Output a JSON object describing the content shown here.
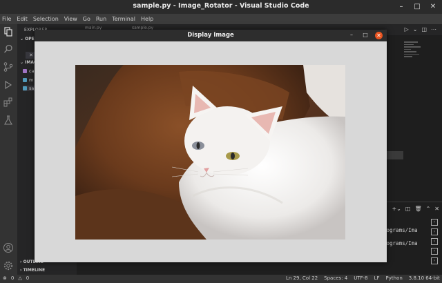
{
  "window": {
    "title": "sample.py - Image_Rotator - Visual Studio Code"
  },
  "menu": [
    "File",
    "Edit",
    "Selection",
    "View",
    "Go",
    "Run",
    "Terminal",
    "Help"
  ],
  "sidebar": {
    "header": "EXPLORER",
    "open_editors": "OPE",
    "folder": "IMAG",
    "files": [
      {
        "label": "ca",
        "color": "#a074c4"
      },
      {
        "label": "m",
        "color": "#519aba"
      },
      {
        "label": "sa",
        "color": "#519aba"
      }
    ],
    "outline": "OUTLINE",
    "timeline": "TIMELINE"
  },
  "editor": {
    "tabs": [
      "main.py",
      "sample.py"
    ]
  },
  "terminal": {
    "lines": [
      "rograms/Ima",
      "rograms/Ima"
    ]
  },
  "statusbar": {
    "errors": "0",
    "warnings": "0",
    "position": "Ln 29, Col 22",
    "spaces": "Spaces: 4",
    "encoding": "UTF-8",
    "eol": "LF",
    "language": "Python",
    "interpreter": "3.8.10 64-bit"
  },
  "display_window": {
    "title": "Display Image",
    "image_subject": "white cat on brown sofa"
  },
  "colors": {
    "accent_close": "#e95420",
    "status_bg": "#333333"
  }
}
